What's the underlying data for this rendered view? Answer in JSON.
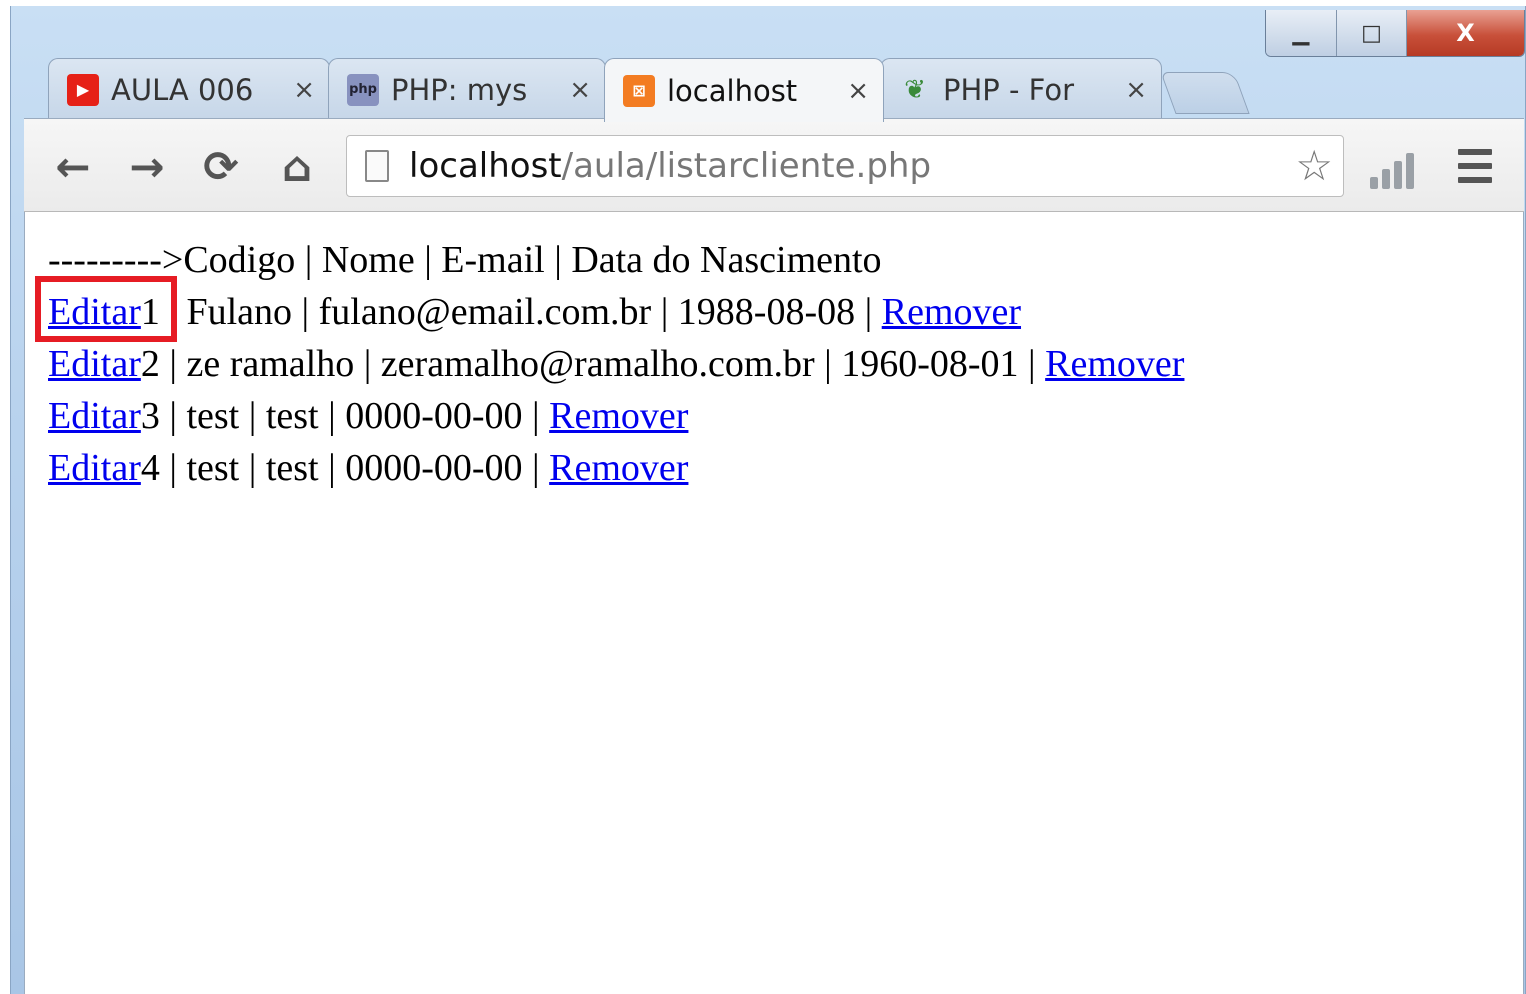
{
  "window": {
    "controls": {
      "minimize": "▁",
      "maximize": "□",
      "close": "X"
    }
  },
  "tabs": [
    {
      "title": "AULA 006",
      "icon": "youtube-icon",
      "icon_color": "#e62117",
      "active": false,
      "close": "×"
    },
    {
      "title": "PHP: mys",
      "icon": "php-icon",
      "icon_color": "#8892bf",
      "active": false,
      "close": "×"
    },
    {
      "title": "localhost",
      "icon": "xampp-icon",
      "icon_color": "#f37c22",
      "active": true,
      "close": "×"
    },
    {
      "title": "PHP - For",
      "icon": "forum-leaf-icon",
      "icon_color": "#3a8a3a",
      "active": false,
      "close": "×"
    }
  ],
  "toolbar": {
    "back": "←",
    "forward": "→",
    "reload": "⟳",
    "home": "⌂",
    "url_host": "localhost",
    "url_path": "/aula/listarcliente.php",
    "bookmark_star": "☆"
  },
  "page": {
    "header": "--------->Codigo | Nome | E-mail | Data do Nascimento",
    "rows": [
      {
        "edit": "Editar",
        "text": "1 | Fulano | fulano@email.com.br | 1988-08-08 | ",
        "remove": "Remover"
      },
      {
        "edit": "Editar",
        "text": "2 | ze ramalho | zeramalho@ramalho.com.br | 1960-08-01 | ",
        "remove": "Remover"
      },
      {
        "edit": "Editar",
        "text": "3 | test | test | 0000-00-00 | ",
        "remove": "Remover"
      },
      {
        "edit": "Editar",
        "text": "4 | test | test | 0000-00-00 | ",
        "remove": "Remover"
      }
    ]
  },
  "annotation_color": "#e61c24",
  "link_color": "#0000ee"
}
